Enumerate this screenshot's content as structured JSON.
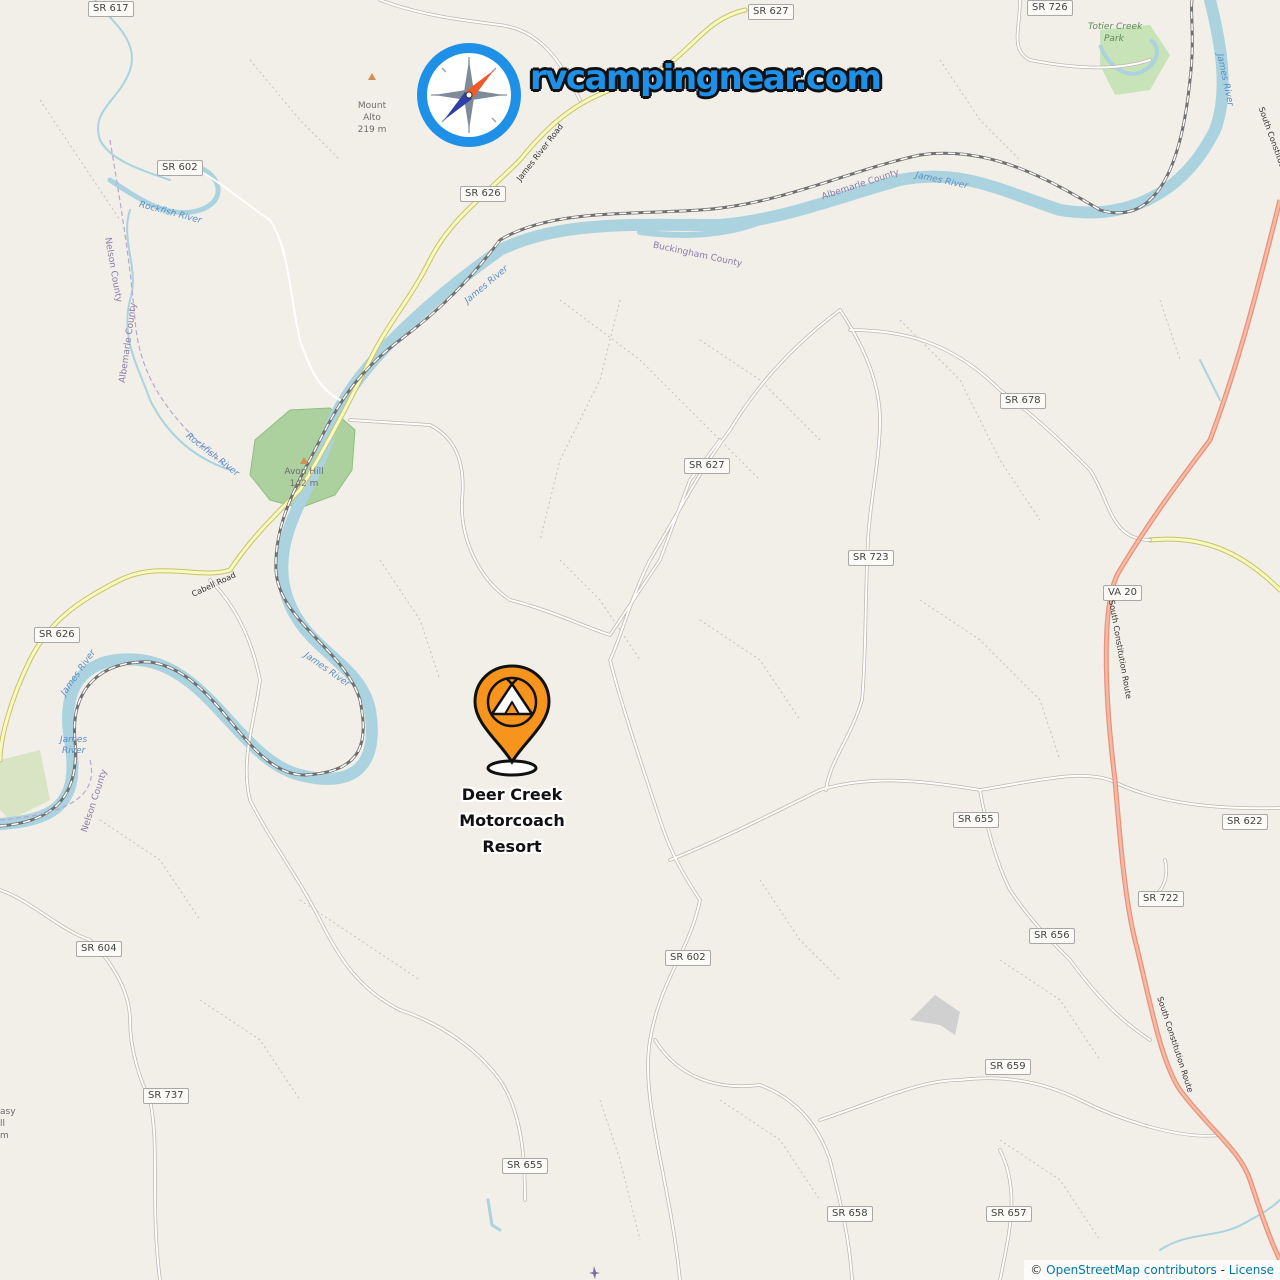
{
  "brand": {
    "name": "rvcampingnear.com"
  },
  "marker": {
    "label": "Deer Creek Motorcoach Resort",
    "icon": "campground-pin-icon",
    "color": "#f7941d"
  },
  "attribution": {
    "copyright": "©",
    "osm_link": "OpenStreetMap contributors",
    "separator": "-",
    "license_link": "License"
  },
  "road_shields": [
    "SR 617",
    "SR 627",
    "SR 726",
    "SR 602",
    "SR 626",
    "SR 678",
    "SR 627",
    "SR 723",
    "VA 20",
    "SR 626",
    "SR 655",
    "SR 622",
    "SR 722",
    "SR 656",
    "SR 604",
    "SR 602",
    "SR 659",
    "SR 737",
    "SR 655",
    "SR 658",
    "SR 657"
  ],
  "place_labels": [
    "Totier Creek",
    "Park"
  ],
  "peaks": [
    {
      "name": "Mount",
      "name2": "Alto",
      "elev": "219 m"
    },
    {
      "name": "Avon Hill",
      "elev": "142 m"
    },
    {
      "name": "asy",
      "name2": "ll",
      "elev": "m"
    }
  ],
  "river_labels": [
    "James River",
    "James River",
    "James River",
    "Rockfish River",
    "Rockfish River",
    "James River",
    "James",
    "River",
    "James River"
  ],
  "county_labels": [
    "Albemarle County",
    "Buckingham County",
    "Nelson County",
    "Albemarle County",
    "Nelson County"
  ],
  "road_labels": [
    "James River Road",
    "Cabell Road",
    "South Constitution Route",
    "South Constitution Route",
    "South Constitution Route"
  ],
  "colors": {
    "land": "#f2efe9",
    "water": "#aad3df",
    "park": "#add19e",
    "highway": "#e8927c",
    "secondary": "#f7fabf",
    "rail": "#707070",
    "brand_blue": "#1e90e8"
  }
}
